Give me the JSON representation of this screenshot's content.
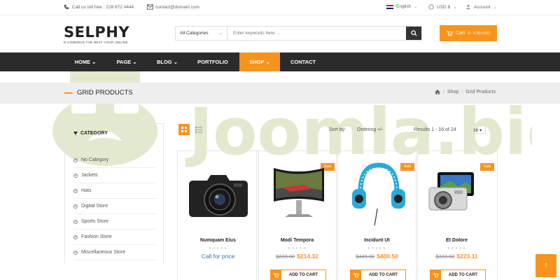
{
  "topbar": {
    "phone": "Call us toll free : 228 872 4444",
    "email": "contact@domain.com",
    "language": "English",
    "currency": "USD $",
    "account": "Account"
  },
  "header": {
    "logo_text": "SELPHY",
    "tagline": "E-COMERCE THE BEST YOUR ONLINE",
    "search": {
      "category": "All Categories",
      "placeholder": "Enter keywords here ..."
    },
    "cart_label": "Cart",
    "cart_sub": "0 - 0.00 USD"
  },
  "nav": [
    {
      "label": "HOME"
    },
    {
      "label": "PAGE"
    },
    {
      "label": "BLOG"
    },
    {
      "label": "PORTFOLIO"
    },
    {
      "label": "SHOP"
    },
    {
      "label": "CONTACT"
    }
  ],
  "page": {
    "title": "GRID PRODUCTS",
    "breadcrumb": [
      "Shop",
      "Grid Products"
    ]
  },
  "sidebar": {
    "heading": "CATEGORY",
    "items": [
      "No Category",
      "Jackets",
      "Hats",
      "Digital Store",
      "Sports Store",
      "Fashion Store",
      "Miscellaneous Store"
    ]
  },
  "toolbar": {
    "sort_label": "Sort by:",
    "sort_value": "Ordering +/-",
    "results": "Results 1 - 16 of 24",
    "per_page": "16"
  },
  "products": [
    {
      "name": "Numquam Eius",
      "call": "Call for price",
      "sale": "",
      "old": "",
      "new": "",
      "cta": ""
    },
    {
      "name": "Modi Tempora",
      "call": "",
      "sale": "Sale",
      "old": "$228.00",
      "new": "$214.32",
      "cta": "ADD TO CART"
    },
    {
      "name": "Incidunt Ut",
      "call": "",
      "sale": "Sale",
      "old": "$445.00",
      "new": "$400.50",
      "cta": "ADD TO CART"
    },
    {
      "name": "Et Dolore",
      "call": "",
      "sale": "Sale",
      "old": "$333.00",
      "new": "$223.11",
      "cta": "ADD TO CART"
    }
  ],
  "watermark": "Joomla.bid",
  "colors": {
    "accent": "#f7941d",
    "nav_bg": "#2b2b2b",
    "watermark": "#e3e9cf"
  }
}
